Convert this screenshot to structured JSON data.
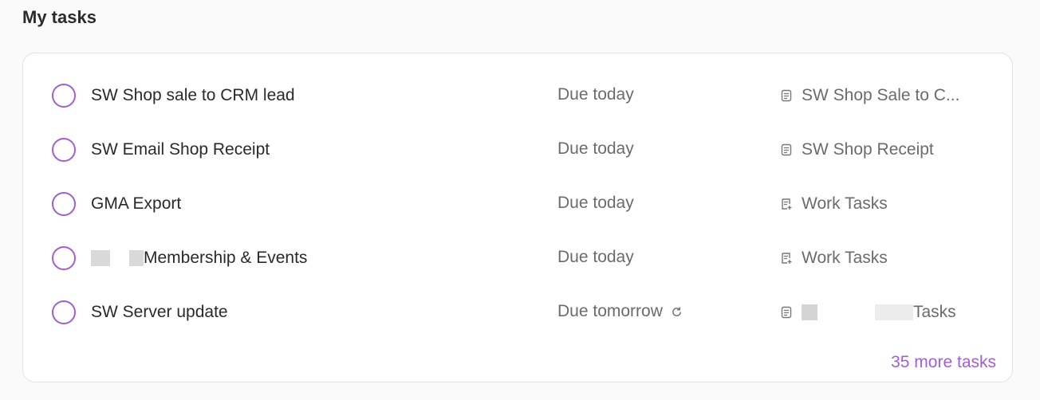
{
  "header": {
    "title": "My tasks"
  },
  "colors": {
    "accent": "#a25ddc",
    "text": "#2a2a2a",
    "muted": "#6b6b6b"
  },
  "tasks": [
    {
      "name": "SW Shop sale to CRM lead",
      "due": "Due today",
      "list": "SW Shop Sale to C...",
      "list_icon": "document-icon"
    },
    {
      "name": "SW Email Shop Receipt",
      "due": "Due today",
      "list": "SW Shop Receipt",
      "list_icon": "document-icon"
    },
    {
      "name": "GMA Export",
      "due": "Due today",
      "list": "Work Tasks",
      "list_icon": "list-plus-icon"
    },
    {
      "name": "Membership & Events",
      "due": "Due today",
      "list": "Work Tasks",
      "list_icon": "list-plus-icon"
    },
    {
      "name": "SW Server update",
      "due": "Due tomorrow",
      "list": "Tasks",
      "list_icon": "document-icon",
      "recurring": true
    }
  ],
  "footer": {
    "more_link": "35 more tasks"
  }
}
